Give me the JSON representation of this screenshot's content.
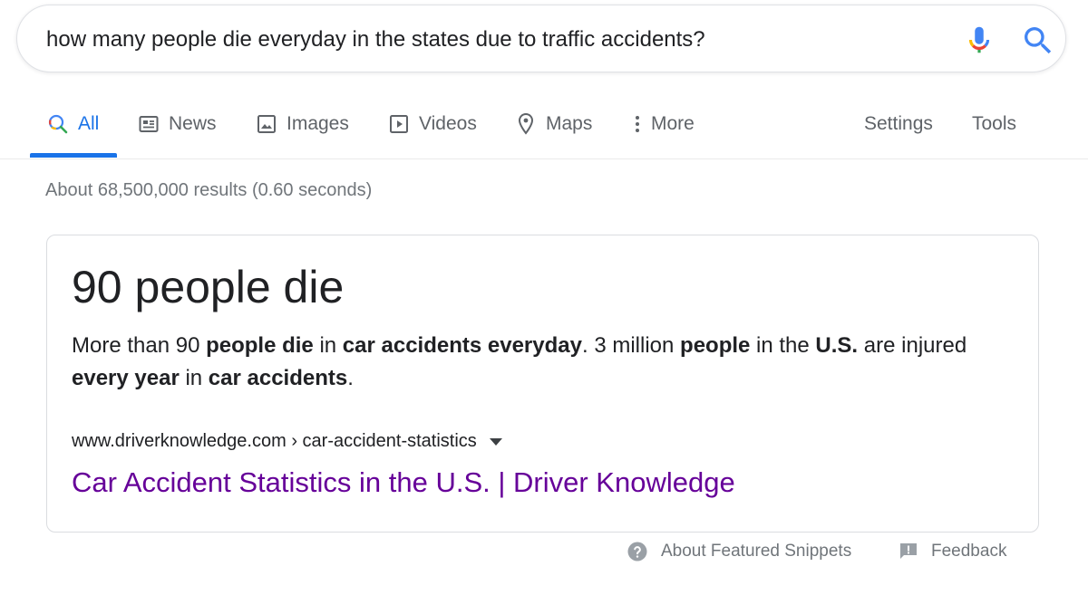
{
  "search": {
    "query": "how many people die everyday in the states due to traffic accidents?",
    "mic_icon": "microphone-icon",
    "search_icon": "search-icon"
  },
  "tabs": {
    "items": [
      {
        "label": "All",
        "icon": "search-icon",
        "active": true
      },
      {
        "label": "News",
        "icon": "newspaper-icon"
      },
      {
        "label": "Images",
        "icon": "image-icon"
      },
      {
        "label": "Videos",
        "icon": "play-icon"
      },
      {
        "label": "Maps",
        "icon": "map-pin-icon"
      },
      {
        "label": "More",
        "icon": "more-vertical-icon"
      }
    ],
    "settings": "Settings",
    "tools": "Tools"
  },
  "results": {
    "stats": "About 68,500,000 results (0.60 seconds)"
  },
  "snippet": {
    "answer": "90 people die",
    "text_parts": [
      {
        "text": "More than 90 ",
        "bold": false
      },
      {
        "text": "people die",
        "bold": true
      },
      {
        "text": " in ",
        "bold": false
      },
      {
        "text": "car accidents everyday",
        "bold": true
      },
      {
        "text": ". 3 million ",
        "bold": false
      },
      {
        "text": "people",
        "bold": true
      },
      {
        "text": " in the ",
        "bold": false
      },
      {
        "text": "U.S.",
        "bold": true
      },
      {
        "text": " are injured ",
        "bold": false
      },
      {
        "text": "every year",
        "bold": true
      },
      {
        "text": " in ",
        "bold": false
      },
      {
        "text": "car accidents",
        "bold": true
      },
      {
        "text": ".",
        "bold": false
      }
    ],
    "cite": "www.driverknowledge.com › car-accident-statistics",
    "title": "Car Accident Statistics in the U.S. | Driver Knowledge"
  },
  "footer": {
    "about": "About Featured Snippets",
    "feedback": "Feedback"
  },
  "colors": {
    "accent": "#1a73e8",
    "visited_link": "#660099",
    "muted_text": "#70757a"
  }
}
